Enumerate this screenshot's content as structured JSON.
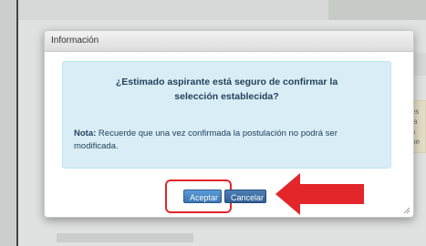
{
  "dialog": {
    "title": "Información",
    "question_line1": "¿Estimado aspirante está seguro de confirmar la",
    "question_line2": "selección establecida?",
    "note_label": "Nota:",
    "note_text": " Recuerde que una vez confirmada la postulación no podrá ser modificada.",
    "accept_label": "Aceptar",
    "cancel_label": "Cancelar"
  },
  "background": {
    "notice_fragments": [
      "les",
      "va",
      "la",
      "me"
    ]
  },
  "colors": {
    "alert_bg": "#d9edf7",
    "button_blue": "#3a77b5",
    "highlight_red": "#e3262a"
  }
}
